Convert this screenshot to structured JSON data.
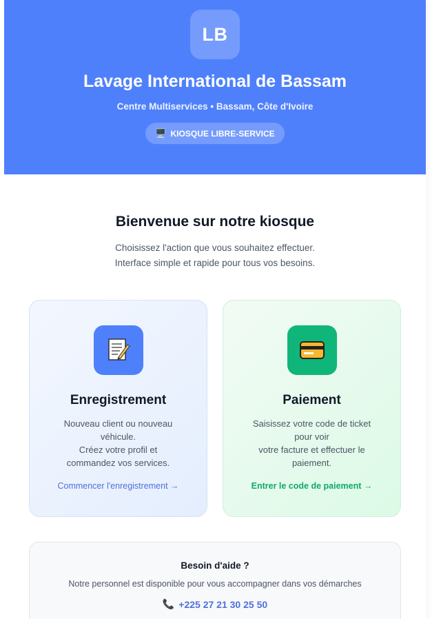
{
  "header": {
    "logo_text": "LB",
    "title": "Lavage International de Bassam",
    "subtitle": "Centre Multiservices • Bassam, Côte d'Ivoire",
    "badge_icon": "monitor-icon",
    "badge_label": "KIOSQUE LIBRE-SERVICE",
    "bg_color": "#4f80fc"
  },
  "welcome": {
    "heading": "Bienvenue sur notre kiosque",
    "line1": "Choisissez l'action que vous souhaitez effectuer.",
    "line2": "Interface simple et rapide pour tous vos besoins."
  },
  "cards": [
    {
      "icon": "memo-icon",
      "title": "Enregistrement",
      "desc_lines": [
        "Nouveau client ou nouveau",
        "véhicule.",
        "Créez votre profil et",
        "commandez vos services."
      ],
      "cta": "Commencer l'enregistrement →",
      "accent": "#4f80fc"
    },
    {
      "icon": "credit-card-icon",
      "title": "Paiement",
      "desc_lines": [
        "Saisissez votre code de ticket",
        "pour voir",
        "votre facture et effectuer le",
        "paiement."
      ],
      "cta": "Entrer le code de paiement →",
      "accent": "#10b57a"
    }
  ],
  "help": {
    "title": "Besoin d'aide ?",
    "text": "Notre personnel est disponible pour vous accompagner dans vos démarches",
    "phone_icon": "telephone-icon",
    "phone": "+225 27 21 30 25 50"
  }
}
